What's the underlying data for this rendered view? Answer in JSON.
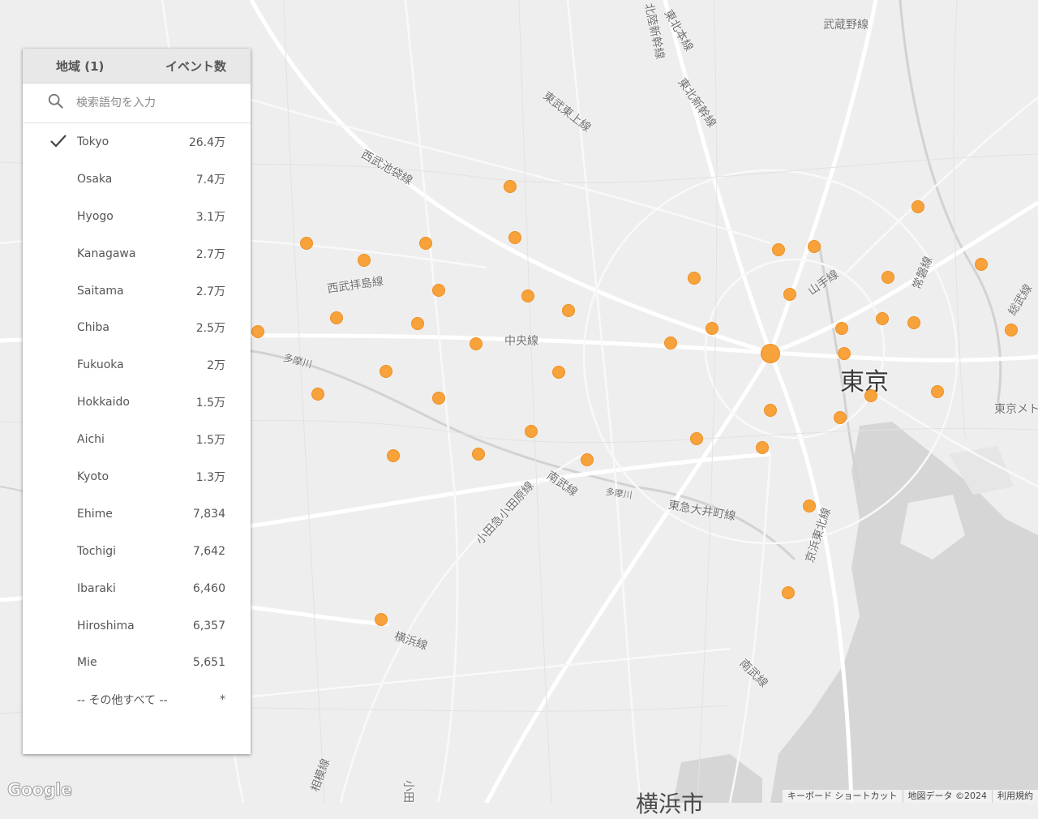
{
  "panel": {
    "region_header": "地域 (1)",
    "events_header": "イベント数",
    "search_placeholder": "検索語句を入力",
    "rows": [
      {
        "name": "Tokyo",
        "value": "26.4万",
        "checked": true
      },
      {
        "name": "Osaka",
        "value": "7.4万",
        "checked": false
      },
      {
        "name": "Hyogo",
        "value": "3.1万",
        "checked": false
      },
      {
        "name": "Kanagawa",
        "value": "2.7万",
        "checked": false
      },
      {
        "name": "Saitama",
        "value": "2.7万",
        "checked": false
      },
      {
        "name": "Chiba",
        "value": "2.5万",
        "checked": false
      },
      {
        "name": "Fukuoka",
        "value": "2万",
        "checked": false
      },
      {
        "name": "Hokkaido",
        "value": "1.5万",
        "checked": false
      },
      {
        "name": "Aichi",
        "value": "1.5万",
        "checked": false
      },
      {
        "name": "Kyoto",
        "value": "1.3万",
        "checked": false
      },
      {
        "name": "Ehime",
        "value": "7,834",
        "checked": false
      },
      {
        "name": "Tochigi",
        "value": "7,642",
        "checked": false
      },
      {
        "name": "Ibaraki",
        "value": "6,460",
        "checked": false
      },
      {
        "name": "Hiroshima",
        "value": "6,357",
        "checked": false
      },
      {
        "name": "Mie",
        "value": "5,651",
        "checked": false
      },
      {
        "name": "-- その他すべて --",
        "value": "*",
        "checked": false
      }
    ]
  },
  "map": {
    "labels": {
      "musashino_line": "武蔵野線",
      "tohoku_line": "東北本線",
      "hokuriku_shinkansen": "北陸新幹線",
      "tohoku_shinkansen": "東北新幹線",
      "tobu_tojo_line": "東武東上線",
      "seibu_ikebukuro_line": "西武池袋線",
      "seibu_haijima_line": "西武拝島線",
      "chuo_line": "中央線",
      "tamagawa": "多摩川",
      "yamanote_line": "山手線",
      "joban_line": "常磐線",
      "sobu_line": "総武線",
      "tokyo_metro": "東京メト",
      "nambu_line": "南武線",
      "odakyu_line": "小田急小田原線",
      "tokyu_oimachi_line": "東急大井町線",
      "keihin_tohoku_line": "京浜東北線",
      "yokohama_line": "横浜線",
      "nambu_line_2": "南武線",
      "sagami_line": "相模線",
      "tama_river_2": "多摩川",
      "odakyu_2": "小田"
    },
    "city_tokyo": "東京",
    "city_yokohama": "横浜市",
    "marker_color": "#f7a23b",
    "logo": "Google",
    "attribution": [
      "キーボード ショートカット",
      "地図データ ©2024",
      "利用規約"
    ]
  }
}
